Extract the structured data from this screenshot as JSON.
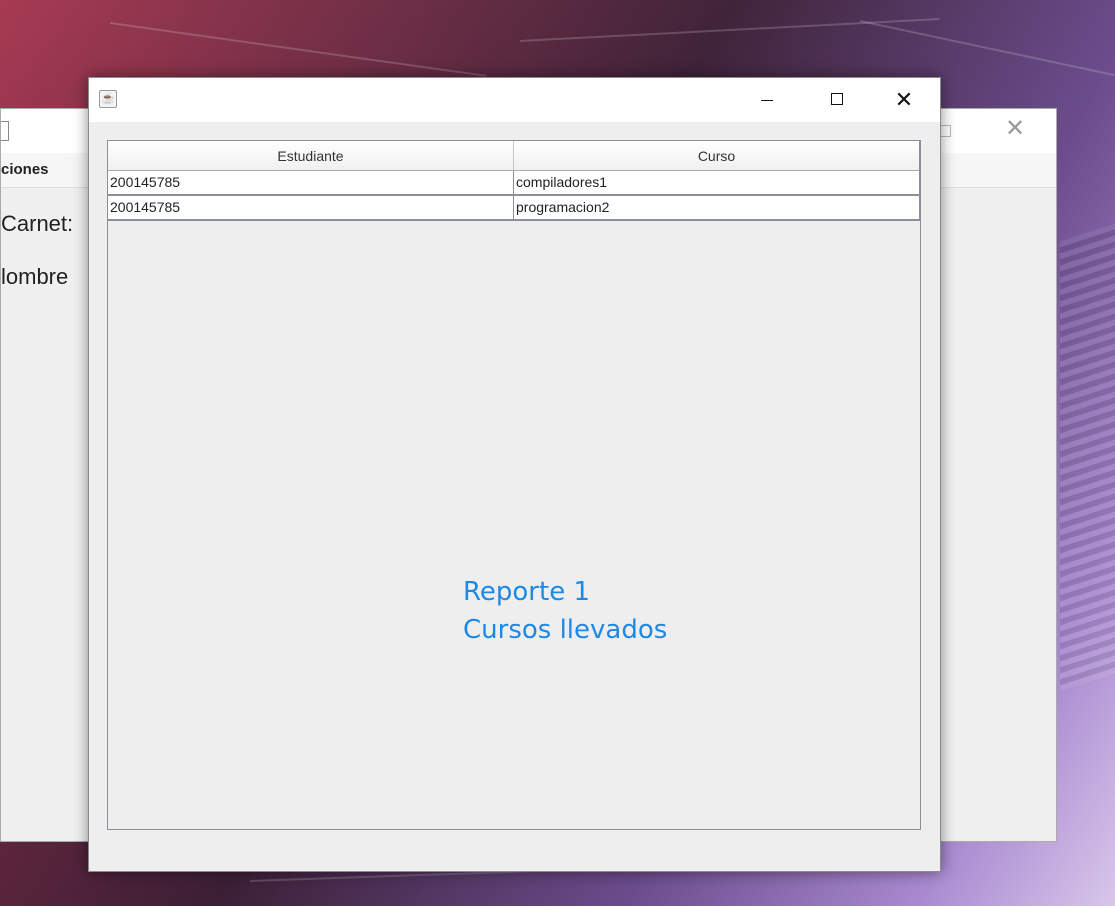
{
  "background_window": {
    "menu_label": "ciones",
    "carnet_label": "Carnet:",
    "nombre_label": "lombre"
  },
  "window": {
    "app_icon": "java-coffee-icon",
    "minimize_glyph": "—",
    "close_glyph": "✕"
  },
  "table": {
    "columns": [
      "Estudiante",
      "Curso"
    ],
    "rows": [
      [
        "200145785",
        "compiladores1"
      ],
      [
        "200145785",
        "programacion2"
      ]
    ]
  },
  "report": {
    "line1": "Reporte 1",
    "line2": "Cursos llevados"
  },
  "colors": {
    "report_text": "#1e88e5",
    "window_bg": "#eeeeee"
  }
}
